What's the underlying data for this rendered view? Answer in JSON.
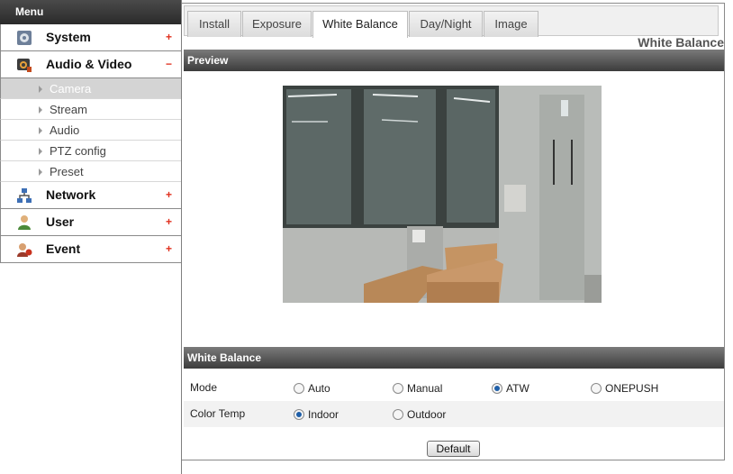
{
  "sidebar": {
    "header": "Menu",
    "categories": [
      {
        "label": "System",
        "toggle": "+",
        "icon": "gear-icon"
      },
      {
        "label": "Audio & Video",
        "toggle": "−",
        "icon": "camera-icon"
      },
      {
        "label": "Network",
        "toggle": "+",
        "icon": "network-icon"
      },
      {
        "label": "User",
        "toggle": "+",
        "icon": "user-icon"
      },
      {
        "label": "Event",
        "toggle": "+",
        "icon": "event-icon"
      }
    ],
    "subitems": [
      {
        "label": "Camera",
        "selected": true
      },
      {
        "label": "Stream",
        "selected": false
      },
      {
        "label": "Audio",
        "selected": false
      },
      {
        "label": "PTZ config",
        "selected": false
      },
      {
        "label": "Preset",
        "selected": false
      }
    ]
  },
  "tabs": [
    {
      "label": "Install",
      "active": false
    },
    {
      "label": "Exposure",
      "active": false
    },
    {
      "label": "White Balance",
      "active": true
    },
    {
      "label": "Day/Night",
      "active": false
    },
    {
      "label": "Image",
      "active": false
    }
  ],
  "page_title": "White Balance",
  "preview": {
    "header": "Preview"
  },
  "white_balance": {
    "header": "White Balance",
    "mode": {
      "label": "Mode",
      "options": [
        "Auto",
        "Manual",
        "ATW",
        "ONEPUSH"
      ],
      "selected": "ATW"
    },
    "color_temp": {
      "label": "Color Temp",
      "options": [
        "Indoor",
        "Outdoor"
      ],
      "selected": "Indoor"
    }
  },
  "default_button": "Default",
  "colors": {
    "accent_radio": "#1f5fa8",
    "toggle_red": "#e0301e",
    "header_dark": "#3c3c3c"
  }
}
